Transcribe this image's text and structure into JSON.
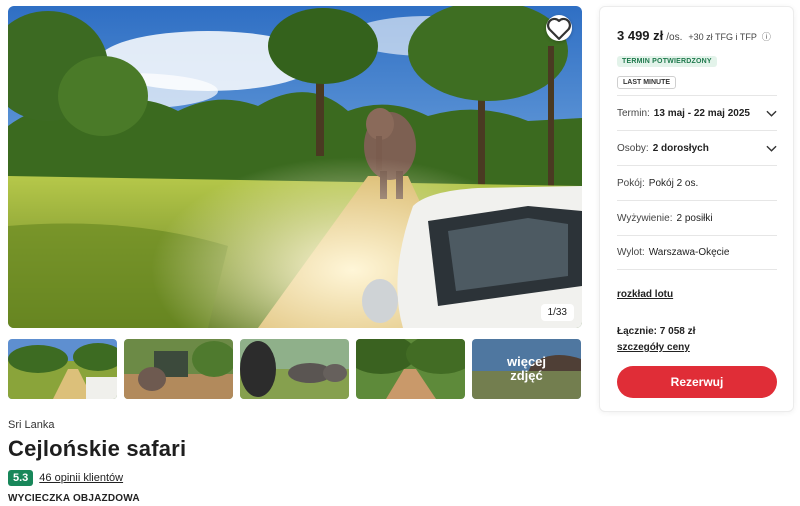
{
  "gallery": {
    "counter": "1/33",
    "more_label_line1": "więcej",
    "more_label_line2": "zdjęć",
    "favorite_icon": "heart-icon"
  },
  "trip": {
    "country": "Sri Lanka",
    "title": "Cejlońskie safari",
    "rating": "5.3",
    "reviews": "46 opinii klientów",
    "type": "WYCIECZKA OBJAZDOWA"
  },
  "booking": {
    "price": "3 499 zł",
    "per_person": "/os.",
    "extra_fees": "+30 zł TFG i TFP",
    "badge_confirmed": "TERMIN POTWIERDZONY",
    "badge_last_minute": "LAST MINUTE",
    "date_label": "Termin:",
    "date_value": "13 maj - 22 maj 2025",
    "persons_label": "Osoby:",
    "persons_value": "2 dorosłych",
    "room_label": "Pokój:",
    "room_value": "Pokój 2 os.",
    "board_label": "Wyżywienie:",
    "board_value": "2 posiłki",
    "departure_label": "Wylot:",
    "departure_value": "Warszawa-Okęcie",
    "flight_schedule": "rozkład lotu",
    "total": "Łącznie: 7 058 zł",
    "price_details": "szczegóły ceny",
    "book_button": "Rezerwuj"
  },
  "colors": {
    "book_button": "#e02d37",
    "rating_badge": "#18875a",
    "confirmed_badge_bg": "#e3f3ea",
    "confirmed_badge_text": "#1f7a4d"
  }
}
